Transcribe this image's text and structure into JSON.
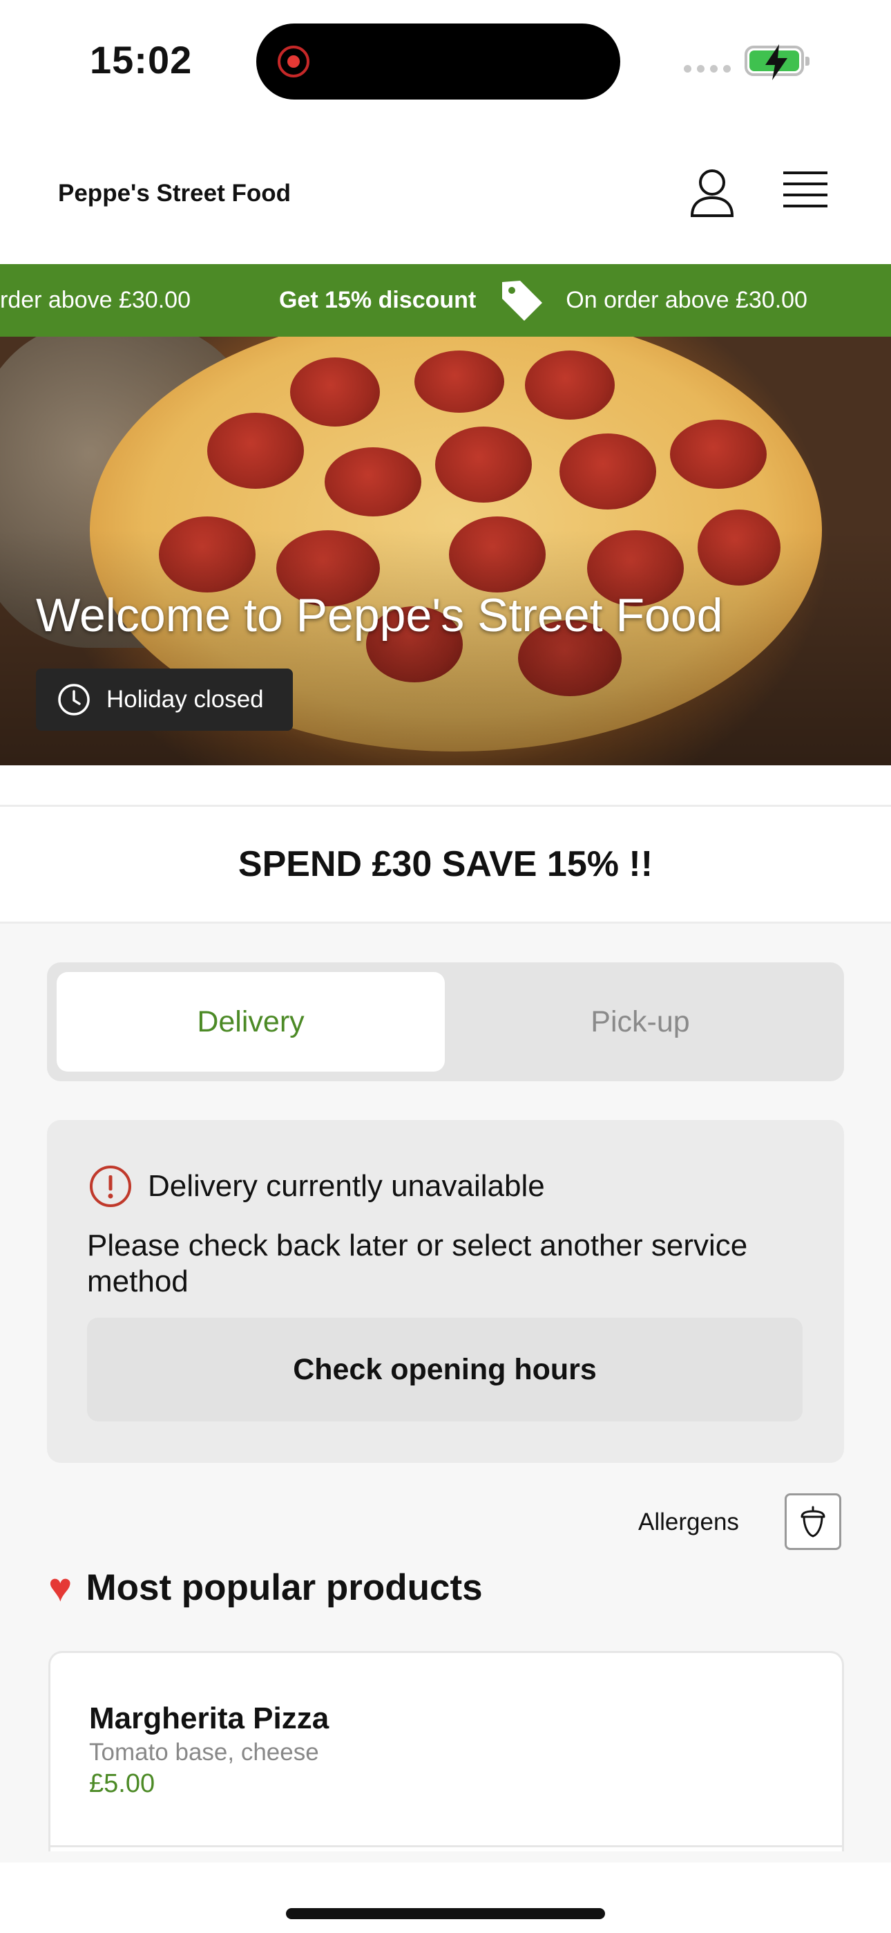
{
  "status_bar": {
    "time": "15:02"
  },
  "header": {
    "brand": "Peppe's Street Food",
    "icons": [
      "user-icon",
      "menu-icon"
    ]
  },
  "promo": {
    "partial_text": "rder above £30.00",
    "discount": "Get 15% discount",
    "condition": "On order above £30.00",
    "background": "#4c8a26"
  },
  "hero": {
    "title": "Welcome to Peppe's Street Food",
    "status": "Holiday closed"
  },
  "announcement": "SPEND £30 SAVE 15% !!",
  "service": {
    "options": [
      "Delivery",
      "Pick-up"
    ],
    "selected": "Delivery"
  },
  "notice": {
    "title": "Delivery currently unavailable",
    "body": "Please check back later or select another service method",
    "button": "Check opening hours"
  },
  "allergens_label": "Allergens",
  "popular": {
    "title": "Most popular products",
    "emoji": "❤️",
    "products": [
      {
        "name": "Margherita Pizza",
        "description": "Tomato base, cheese",
        "price": "£5.00"
      }
    ]
  },
  "colors": {
    "accent_green": "#4c8a26",
    "alert_red": "#c0392b"
  }
}
